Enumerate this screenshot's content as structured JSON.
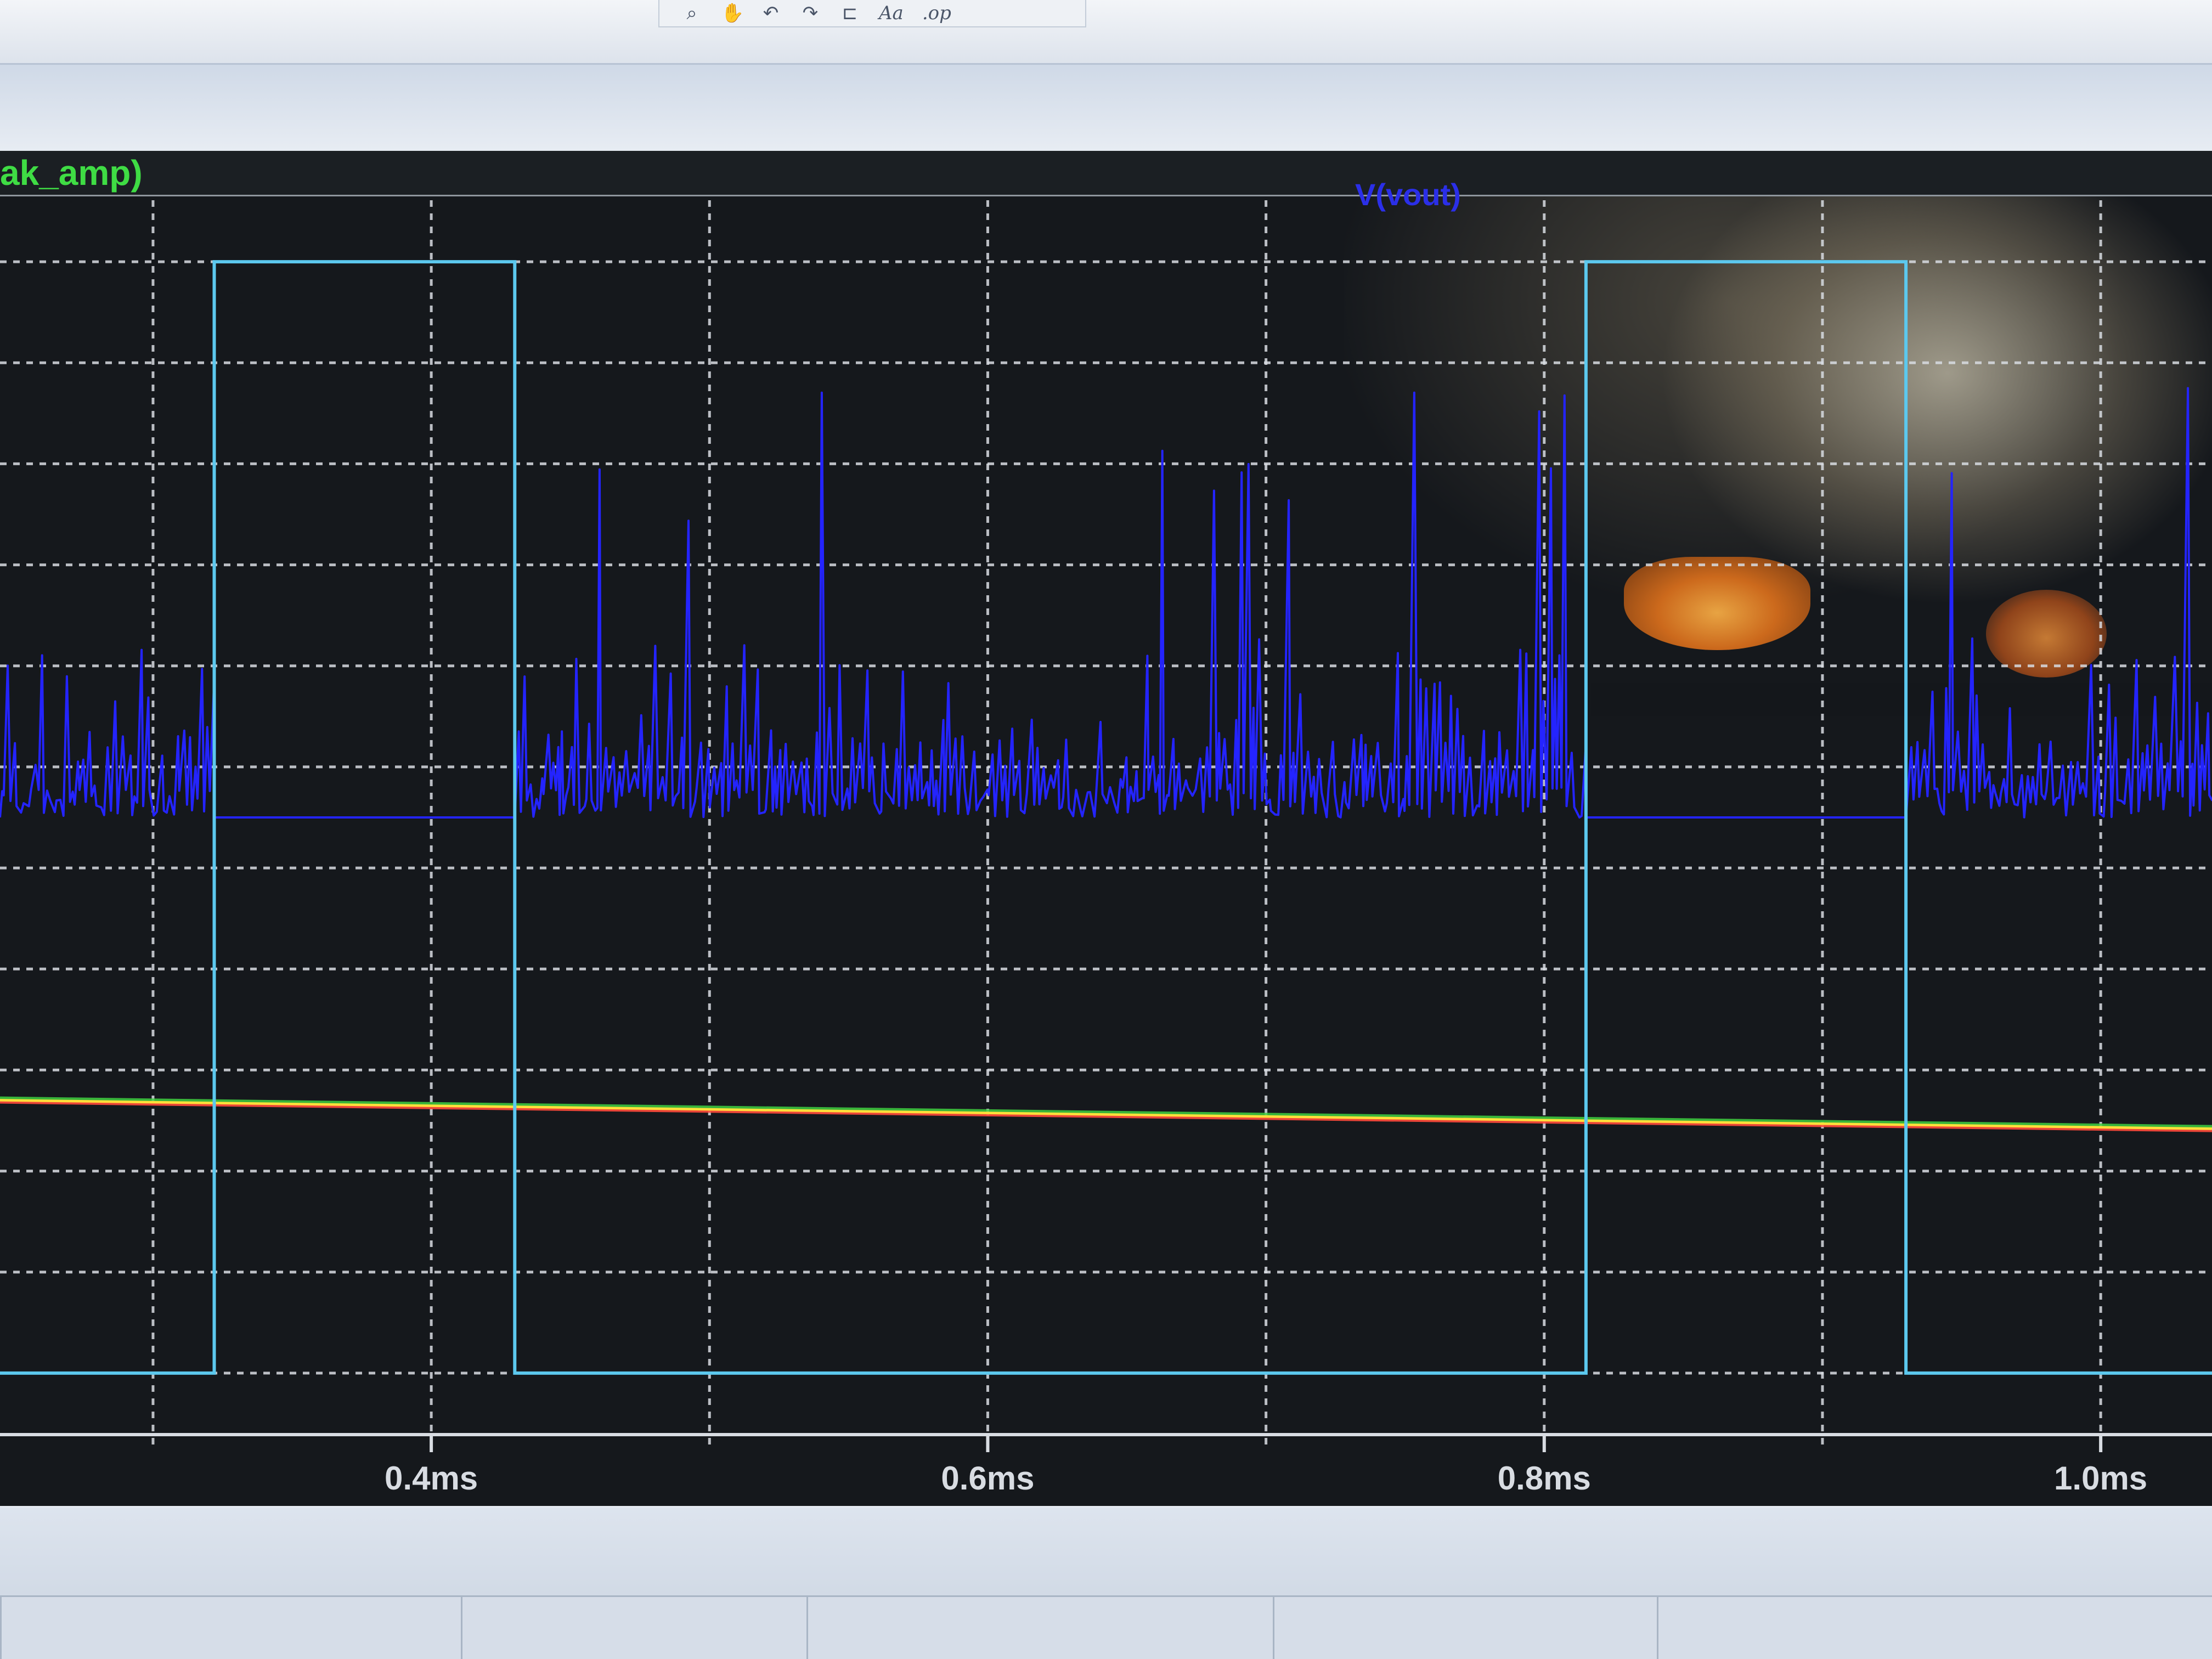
{
  "toolbar": {
    "icons": [
      "zoom-icon",
      "pan-icon",
      "undo-icon",
      "redo-icon",
      "draw-line-icon",
      "text-font-icon",
      "spice-directive-icon"
    ],
    "text_tool_label": "Aa",
    "directive_label": ".op"
  },
  "plot": {
    "left_trace_label": "ak_amp)",
    "center_trace_label": "V(vout)"
  },
  "colors": {
    "background": "#15181c",
    "grid": "#d8dce2",
    "square_wave": "#5cc8ee",
    "vout": "#2424ff",
    "flat_red": "#ff4a3a",
    "flat_yellow": "#ffe03a",
    "flat_green": "#40d040",
    "left_label": "#3fdc44",
    "center_label": "#2b2fe8"
  },
  "chart_data": {
    "type": "line",
    "title": "",
    "xlabel": "",
    "ylabel": "",
    "x_unit": "ms",
    "xlim": [
      0.245,
      1.04
    ],
    "ylim": [
      0,
      12
    ],
    "x_ticks": [
      {
        "value": 0.4,
        "label": "0.4ms"
      },
      {
        "value": 0.6,
        "label": "0.6ms"
      },
      {
        "value": 0.8,
        "label": "0.8ms"
      },
      {
        "value": 1.0,
        "label": "1.0ms"
      }
    ],
    "x_grid": [
      0.3,
      0.4,
      0.5,
      0.6,
      0.7,
      0.8,
      0.9,
      1.0
    ],
    "y_grid": [
      0.5,
      1.5,
      2.5,
      3.5,
      4.5,
      5.5,
      6.5,
      7.5,
      8.5,
      9.5,
      10.5,
      11.5
    ],
    "grid": true,
    "series": [
      {
        "name": "",
        "style": "square",
        "x": [
          0.245,
          0.322,
          0.322,
          0.43,
          0.43,
          0.815,
          0.815,
          0.93,
          0.93,
          1.04
        ],
        "y": [
          0.5,
          0.5,
          11.5,
          11.5,
          0.5,
          0.5,
          11.5,
          11.5,
          0.5,
          0.5
        ]
      },
      {
        "name": "V(vout)",
        "style": "noise",
        "baseline": 6.0,
        "segments": [
          {
            "x_start": 0.245,
            "x_end": 0.322,
            "active": true
          },
          {
            "x_start": 0.322,
            "x_end": 0.43,
            "active": false
          },
          {
            "x_start": 0.43,
            "x_end": 0.815,
            "active": true
          },
          {
            "x_start": 0.815,
            "x_end": 0.93,
            "active": false
          },
          {
            "x_start": 0.93,
            "x_end": 1.04,
            "active": true
          }
        ],
        "typical_peak": 7.5,
        "max_peak": 10.5
      },
      {
        "name": "",
        "style": "flat",
        "y": 3.2
      }
    ]
  }
}
